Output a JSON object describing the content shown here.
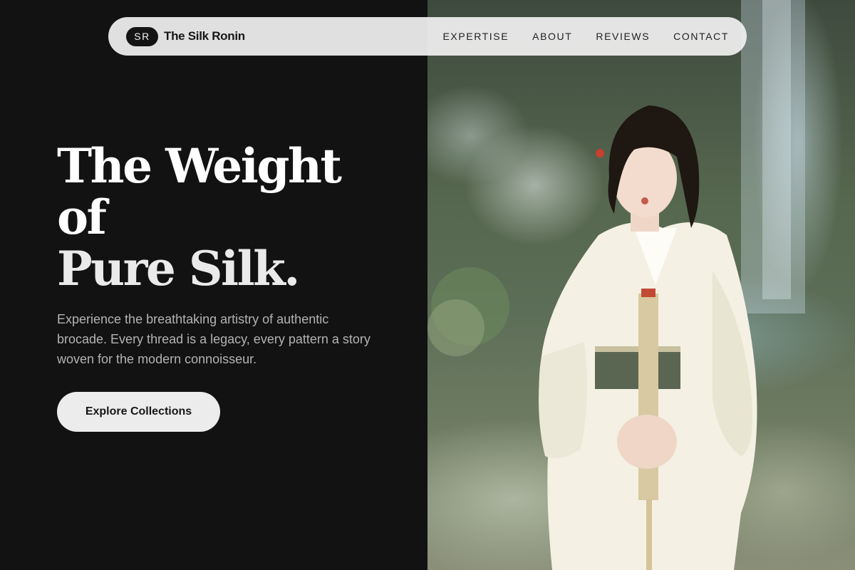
{
  "brand": {
    "badge": "SR",
    "name": "The Silk Ronin"
  },
  "nav": {
    "items": [
      {
        "label": "EXPERTISE"
      },
      {
        "label": "ABOUT"
      },
      {
        "label": "REVIEWS"
      },
      {
        "label": "CONTACT"
      }
    ]
  },
  "hero": {
    "headline_lines": [
      "The Weight",
      "of",
      "Pure Silk."
    ],
    "description": "Experience the breathtaking artistry of authentic brocade. Every thread is a legacy, every pattern a story woven for the modern connoisseur.",
    "cta_label": "Explore Collections"
  },
  "colors": {
    "background": "#121212",
    "nav_pill": "#f0f0f0",
    "cta_bg": "#ececec",
    "headline": "#ffffff",
    "body_text": "#b3b3b3"
  }
}
